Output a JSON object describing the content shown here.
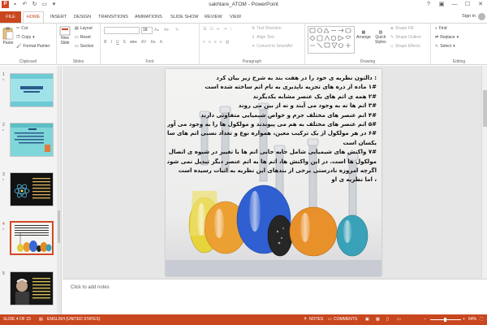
{
  "window": {
    "title": "sakhtare_ATOM - PowerPoint",
    "controls": [
      "?",
      "▣",
      "—",
      "☐",
      "✕"
    ]
  },
  "tabs": {
    "file": "FILE",
    "items": [
      "HOME",
      "INSERT",
      "DESIGN",
      "TRANSITIONS",
      "ANIMATIONS",
      "SLIDE SHOW",
      "REVIEW",
      "VIEW"
    ],
    "sign_in": "Sign in"
  },
  "ribbon": {
    "clipboard": {
      "label": "Clipboard",
      "paste": "Paste",
      "cut": "Cut",
      "copy": "Copy",
      "format_painter": "Format Painter"
    },
    "slides": {
      "label": "Slides",
      "new_slide": "New",
      "new_slide2": "Slide",
      "layout": "Layout",
      "reset": "Reset",
      "section": "Section"
    },
    "font": {
      "label": "Font",
      "size": "18"
    },
    "paragraph": {
      "label": "Paragraph",
      "text_direction": "Text Direction",
      "align_text": "Align Text",
      "convert_smartart": "Convert to SmartArt"
    },
    "drawing": {
      "label": "Drawing",
      "arrange": "Arrange",
      "quick_styles": "Quick",
      "quick_styles2": "Styles",
      "shape_fill": "Shape Fill",
      "shape_outline": "Shape Outline",
      "shape_effects": "Shape Effects"
    },
    "editing": {
      "label": "Editing",
      "find": "Find",
      "replace": "Replace",
      "select": "Select"
    }
  },
  "thumbnails": [
    {
      "num": "1",
      "star": "*"
    },
    {
      "num": "2",
      "star": "*"
    },
    {
      "num": "3",
      "star": "*"
    },
    {
      "num": "4",
      "star": "*"
    },
    {
      "num": "5",
      "star": ""
    }
  ],
  "slide": {
    "lines": [
      ": دالتون نظریه ی خود را در هفت بند به شرح زیر بیان کرد",
      "۱# ماده از ذره های تجزیه ناپذیری به نام اتم ساخته شده است",
      "۲# همه ی اتم های یک عنصر مشابه یکدیگرند",
      "۳# اتم ها نه به وجود می آیند و نه از بین می روند",
      "۴# اتم عنصر های مختلف جرم و خواص شیمیایی متفاوتی دارند",
      "۵# اتم عنصر های مختلف به هم می پیوندند و مولکول ها را به وجود می آورند",
      "۶# در هر مولکول از یک ترکیب معین، همواره نوع و تعداد نسبی اتم های سازنده ی آن",
      "یکسان است",
      "۷# واکنش های شیمیایی شامل جابه جایی اتم ها یا تغییر در شیوه ی اتصال آنها در",
      "مولکول ها است. در این واکنش ها، اتم ها به اتم عنصر دیگر تبدیل نمی شوند",
      "اگرچه امروزه نادرستی برخی از بندهای این نظریه به اثبات رسیده است",
      "، اما نظریه ی او"
    ]
  },
  "notes": {
    "placeholder": "Click to add notes"
  },
  "status": {
    "slide": "SLIDE 4 OF 23",
    "language": "ENGLISH (UNITED STATES)",
    "notes": "NOTES",
    "comments": "COMMENTS",
    "zoom": "64%"
  },
  "colors": {
    "accent": "#c9471f"
  }
}
